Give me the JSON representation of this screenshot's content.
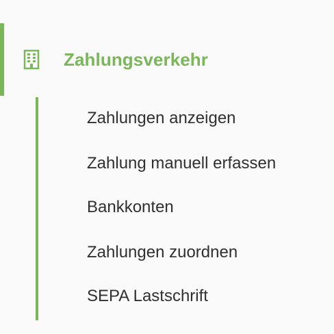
{
  "section": {
    "title": "Zahlungsverkehr",
    "icon": "building-icon",
    "accent_color": "#7ab65a"
  },
  "submenu": {
    "items": [
      {
        "label": "Zahlungen anzeigen"
      },
      {
        "label": "Zahlung manuell erfassen"
      },
      {
        "label": "Bankkonten"
      },
      {
        "label": "Zahlungen zuordnen"
      },
      {
        "label": "SEPA Lastschrift"
      }
    ]
  }
}
